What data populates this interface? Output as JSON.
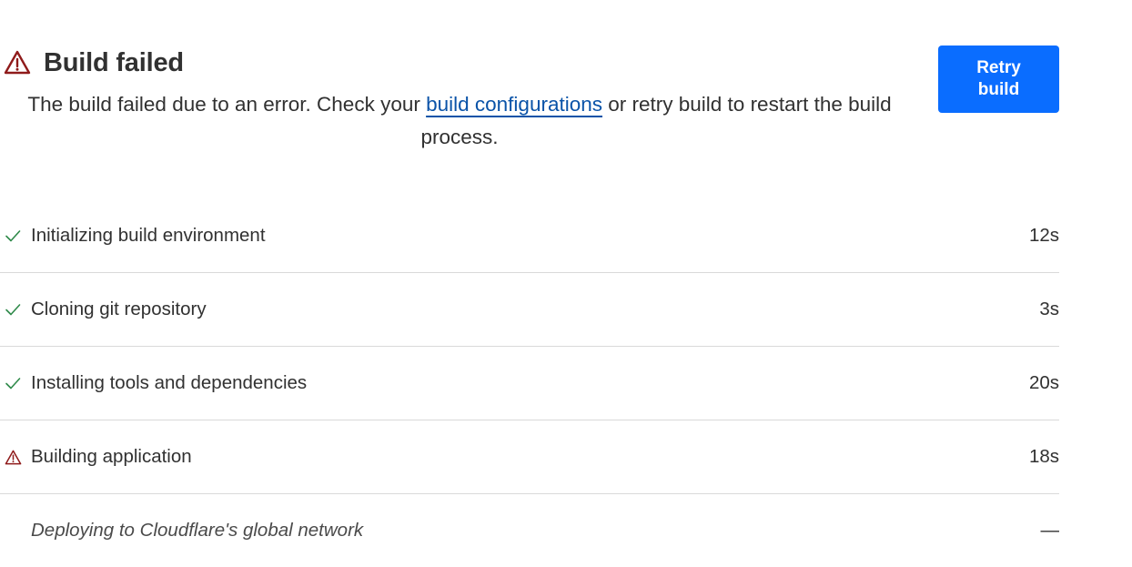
{
  "header": {
    "title": "Build failed",
    "desc_before": "The build failed due to an error. Check your ",
    "desc_link": "build configurations",
    "desc_after": " or retry build to restart the build process."
  },
  "actions": {
    "retry_label": "Retry build"
  },
  "steps": [
    {
      "label": "Initializing build environment",
      "duration": "12s",
      "status": "success"
    },
    {
      "label": "Cloning git repository",
      "duration": "3s",
      "status": "success"
    },
    {
      "label": "Installing tools and dependencies",
      "duration": "20s",
      "status": "success"
    },
    {
      "label": "Building application",
      "duration": "18s",
      "status": "failed"
    },
    {
      "label": "Deploying to Cloudflare's global network",
      "duration": "—",
      "status": "pending"
    }
  ],
  "colors": {
    "error": "#8f1b1b",
    "success": "#2f8a4a",
    "primary": "#0a6dff",
    "link": "#0a53a8"
  }
}
